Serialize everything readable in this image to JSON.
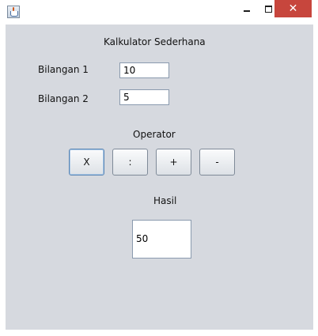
{
  "window": {
    "app_icon": "java-coffee-cup-icon",
    "minimize_icon": "minimize-icon",
    "maximize_icon": "maximize-icon",
    "close_icon": "close-icon",
    "close_glyph": "✕",
    "close_color": "#c7463d"
  },
  "form": {
    "title": "Kalkulator Sederhana",
    "bilangan1_label": "Bilangan 1",
    "bilangan1_value": "10",
    "bilangan2_label": "Bilangan 2",
    "bilangan2_value": "5",
    "operator_label": "Operator",
    "operators": {
      "multiply": "X",
      "divide": ":",
      "add": "+",
      "subtract": "-"
    },
    "hasil_label": "Hasil",
    "hasil_value": "50"
  },
  "colors": {
    "panel_background": "#d6d9df",
    "focus_border": "#5b86b4"
  }
}
